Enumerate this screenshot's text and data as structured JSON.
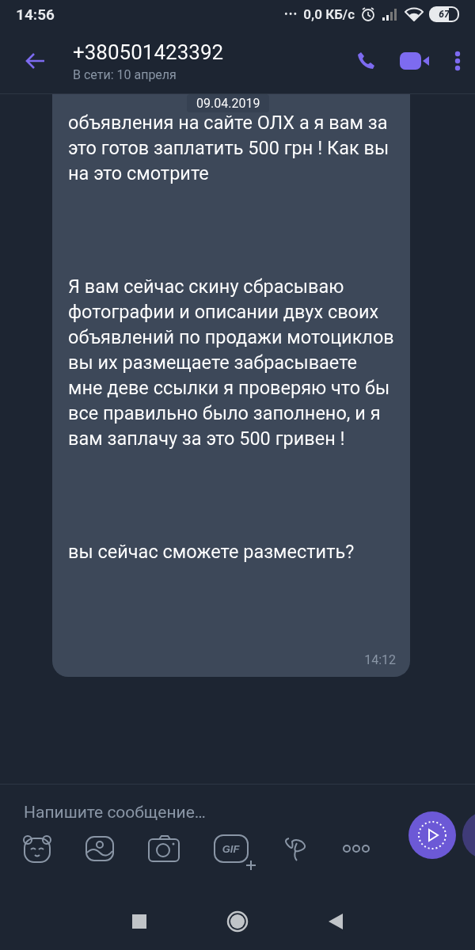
{
  "status_bar": {
    "time": "14:56",
    "dots": "•••",
    "speed": "0,0 КБ/с",
    "battery": "67"
  },
  "header": {
    "title": "+380501423392",
    "subtitle": "В сети: 10 апреля"
  },
  "date_pill": "09.04.2019",
  "message": {
    "paragraphs": [
      "объявления на сайте ОЛХ а я вам за это готов заплатить 500 грн ! Как вы на это смотрите",
      "Я вам сейчас скину сбрасываю фотографии и описании двух своих объявлений по продажи мотоциклов вы их размещаете забрасываете мне деве ссылки я проверяю что бы все правильно было заполнено, и я  вам заплачу за это 500 гривен  !",
      "вы сейчас сможете разместить?"
    ],
    "time": "14:12"
  },
  "composer": {
    "placeholder": "Напишите сообщение…",
    "gif_label": "GIF"
  }
}
